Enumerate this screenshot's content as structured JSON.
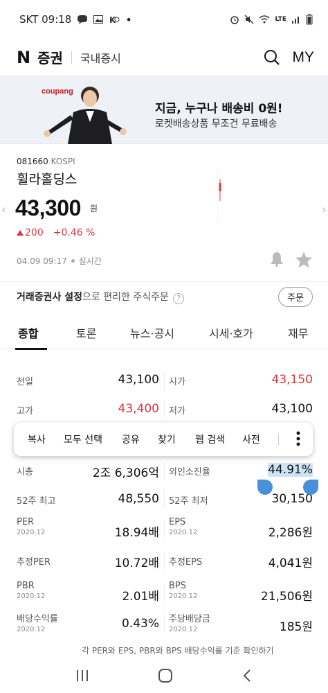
{
  "status_bar": {
    "carrier_time": "SKT 09:18",
    "right_text": "LTE"
  },
  "header": {
    "logo": "N",
    "brand": "증권",
    "section": "국내증시",
    "my_label": "MY"
  },
  "ad": {
    "brand": "coupang",
    "headline": "지금, 누구나 배송비 0원!",
    "subline": "로켓배송상품 무조건 무료배송"
  },
  "stock": {
    "code": "081660",
    "market": "KOSPI",
    "name": "휠라홀딩스",
    "price": "43,300",
    "unit": "원",
    "change_abs": "200",
    "change_pct": "+0.46 %",
    "timestamp": "04.09 09:17",
    "live_label": "실시간"
  },
  "order": {
    "bold": "거래증권사 설정",
    "rest": "으로 편리한 주식주문",
    "help": "?",
    "button": "주문"
  },
  "tabs": [
    "종합",
    "토론",
    "뉴스·공시",
    "시세·호가",
    "재무"
  ],
  "table": [
    {
      "l1": "전일",
      "v1": "43,100",
      "l2": "시가",
      "v2": "43,150",
      "v2_red": true
    },
    {
      "l1": "고가",
      "v1": "43,400",
      "v1_red": true,
      "l2": "저가",
      "v2": "43,100"
    },
    {
      "l1": "시총",
      "v1": "2조 6,306억",
      "l2": "외인소진율",
      "v2": "44.91%"
    },
    {
      "l1": "52주 최고",
      "v1": "48,550",
      "l2": "52주 최저",
      "v2": "30,150"
    },
    {
      "l1": "PER",
      "l1_sub": "2020.12",
      "v1": "18.94배",
      "l2": "EPS",
      "l2_sub": "2020.12",
      "v2": "2,286원"
    },
    {
      "l1": "추정PER",
      "v1": "10.72배",
      "l2": "추정EPS",
      "v2": "4,041원"
    },
    {
      "l1": "PBR",
      "l1_sub": "2020.12",
      "v1": "2.01배",
      "l2": "BPS",
      "l2_sub": "2020.12",
      "v2": "21,506원"
    },
    {
      "l1": "배당수익률",
      "l1_sub": "2020.12",
      "v1": "0.43%",
      "l2": "주당배당금",
      "l2_sub": "2020.12",
      "v2": "185원"
    }
  ],
  "context_menu": [
    "복사",
    "모두 선택",
    "공유",
    "찾기",
    "웹 검색",
    "사전"
  ],
  "footnote": "각 PER와 EPS, PBR와 BPS 배당수익률 기준 확인하기",
  "colors": {
    "up": "#d9363e",
    "selection": "#4a90d9"
  }
}
